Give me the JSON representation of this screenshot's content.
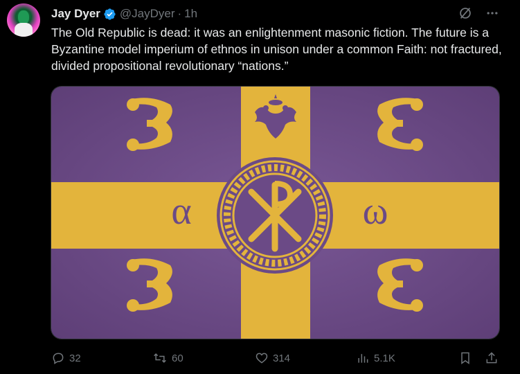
{
  "author": {
    "name": "Jay Dyer",
    "handle": "@JayDyer",
    "separator": "·",
    "time": "1h",
    "verified": true
  },
  "icons": {
    "verified": "verified-badge-icon",
    "grok": "grok-icon",
    "more": "more-icon"
  },
  "tweet": {
    "text": "The Old Republic is dead: it was an enlightenment masonic fiction. The future is a Byzantine model imperium of ethnos in unison under a common Faith: not fractured, divided propositional revolutionary “nations.”"
  },
  "media": {
    "flag": {
      "left_symbols": [
        "α"
      ],
      "right_symbols": [
        "ω"
      ],
      "colors": {
        "field": "#6b4a86",
        "cross": "#e3b43c",
        "firesteel": "#e3b43c"
      }
    }
  },
  "actions": {
    "replies": "32",
    "reposts": "60",
    "likes": "314",
    "views": "5.1K"
  },
  "colors": {
    "background": "#000000",
    "text": "#e7e9ea",
    "muted": "#71767b",
    "verified": "#1d9bf0"
  }
}
